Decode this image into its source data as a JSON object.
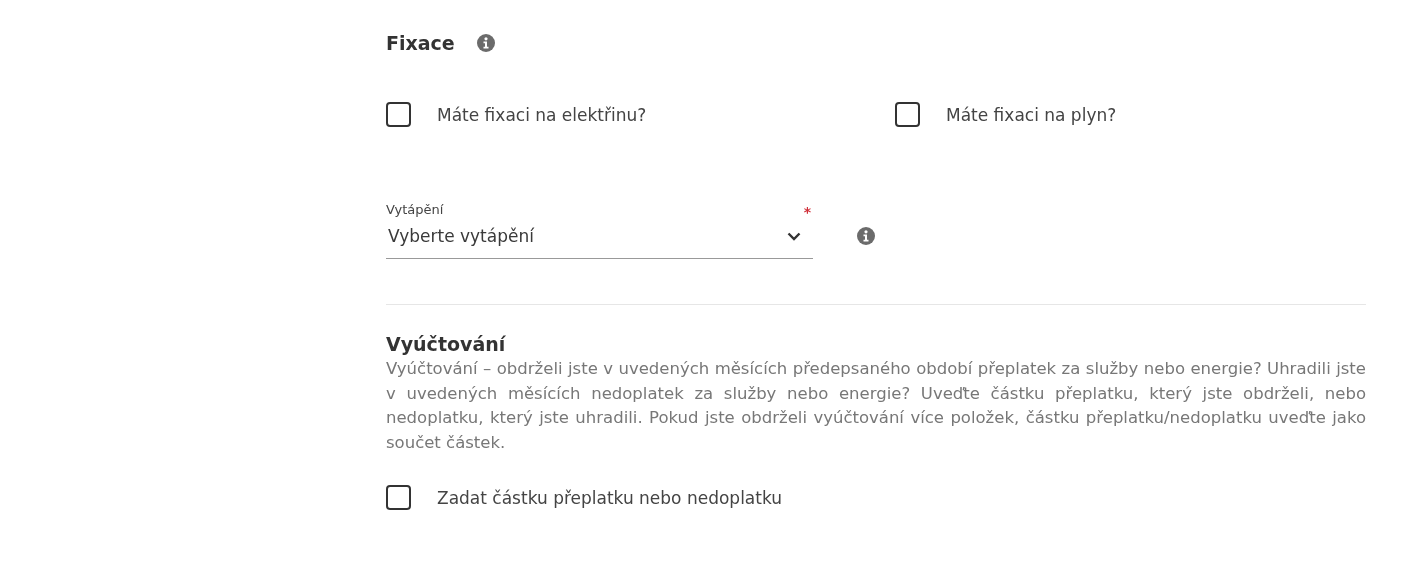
{
  "fixace": {
    "title": "Fixace",
    "checkboxes": [
      {
        "label": "Máte fixaci na elektřinu?",
        "checked": false
      },
      {
        "label": "Máte fixaci na plyn?",
        "checked": false
      }
    ]
  },
  "heating": {
    "label": "Vytápění",
    "required_mark": "*",
    "placeholder": "Vyberte vytápění"
  },
  "billing": {
    "title": "Vyúčtování",
    "description": "Vyúčtování – obdrželi jste v uvedených měsících předepsaného období přeplatek za služby nebo energie? Uhradili jste v uvedených měsících nedoplatek za služby nebo energie? Uveďte částku přeplatku, který jste obdrželi, nebo nedoplatku, který jste uhradili. Pokud jste obdrželi vyúčtování více položek, částku přeplatku/nedoplatku uveďte jako součet částek.",
    "checkbox": {
      "label": "Zadat částku přeplatku nebo nedoplatku",
      "checked": false
    }
  }
}
